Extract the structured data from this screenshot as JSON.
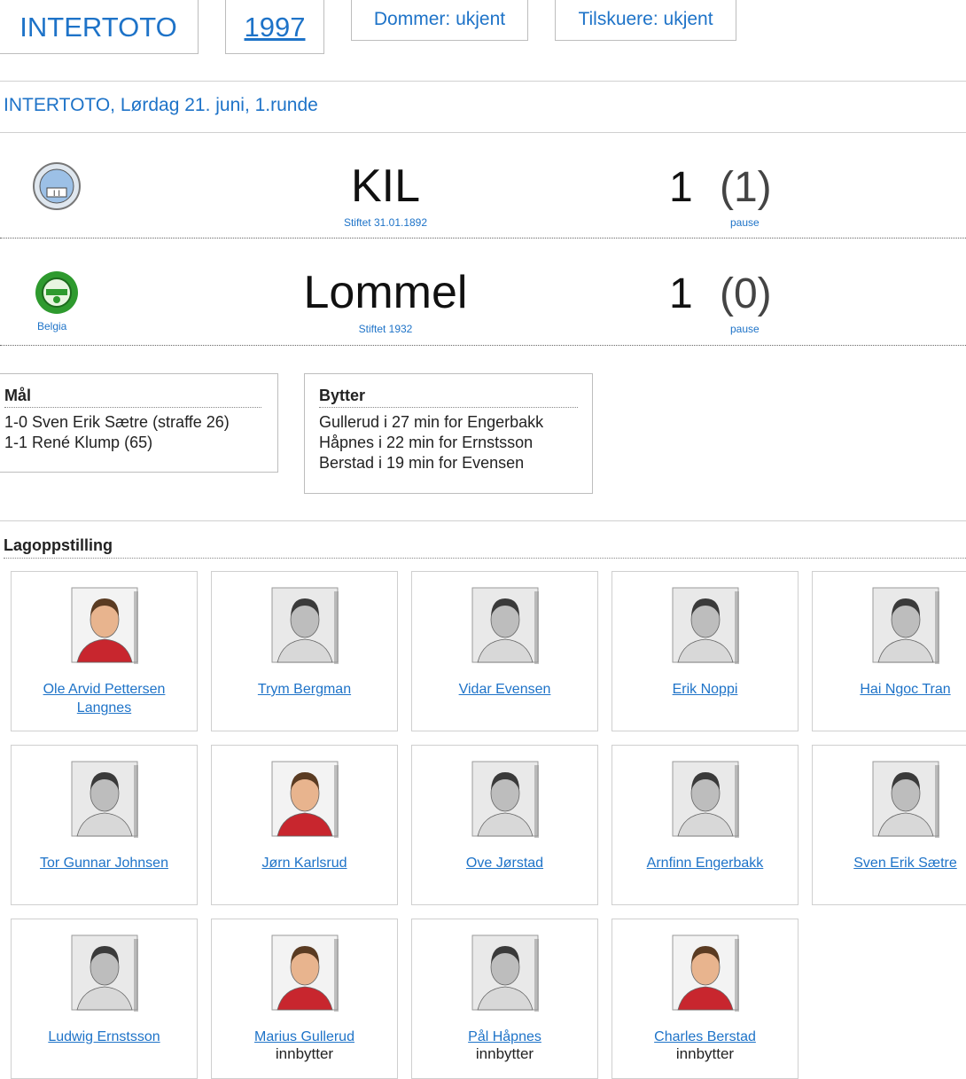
{
  "header": {
    "competition": "INTERTOTO",
    "year": "1997",
    "referee": "Dommer: ukjent",
    "spectators": "Tilskuere: ukjent"
  },
  "match_title": "INTERTOTO, Lørdag 21. juni, 1.runde",
  "home": {
    "name": "KIL",
    "founded": "Stiftet 31.01.1892",
    "score": "1",
    "halftime": "(1)",
    "pause_label": "pause",
    "crest_color": "#8fb6e0"
  },
  "away": {
    "name": "Lommel",
    "country": "Belgia",
    "founded": "Stiftet 1932",
    "score": "1",
    "halftime": "(0)",
    "pause_label": "pause",
    "crest_color": "#3fae3f"
  },
  "goals": {
    "heading": "Mål",
    "items": [
      "1-0 Sven Erik Sætre (straffe 26)",
      "1-1 René Klump (65)"
    ]
  },
  "subs": {
    "heading": "Bytter",
    "items": [
      "Gullerud i 27 min for Engerbakk",
      "Håpnes i 22 min for Ernstsson",
      "Berstad i 19 min for Evensen"
    ]
  },
  "lineup": {
    "heading": "Lagoppstilling",
    "players": [
      {
        "name": "Ole Arvid Pettersen Langnes",
        "role": "",
        "photo": "color"
      },
      {
        "name": "Trym Bergman",
        "role": "",
        "photo": "bw"
      },
      {
        "name": "Vidar Evensen",
        "role": "",
        "photo": "bw"
      },
      {
        "name": "Erik Noppi",
        "role": "",
        "photo": "bw"
      },
      {
        "name": "Hai Ngoc Tran",
        "role": "",
        "photo": "bw"
      },
      {
        "name": "Tor Gunnar Johnsen",
        "role": "",
        "photo": "bw"
      },
      {
        "name": "Jørn Karlsrud",
        "role": "",
        "photo": "color"
      },
      {
        "name": "Ove Jørstad",
        "role": "",
        "photo": "bw"
      },
      {
        "name": "Arnfinn Engerbakk",
        "role": "",
        "photo": "bw"
      },
      {
        "name": "Sven Erik Sætre",
        "role": "",
        "photo": "bw"
      },
      {
        "name": "Ludwig Ernstsson",
        "role": "",
        "photo": "bw"
      },
      {
        "name": "Marius Gullerud",
        "role": "innbytter",
        "photo": "color"
      },
      {
        "name": "Pål Håpnes",
        "role": "innbytter",
        "photo": "bw"
      },
      {
        "name": "Charles Berstad",
        "role": "innbytter",
        "photo": "color"
      }
    ]
  }
}
